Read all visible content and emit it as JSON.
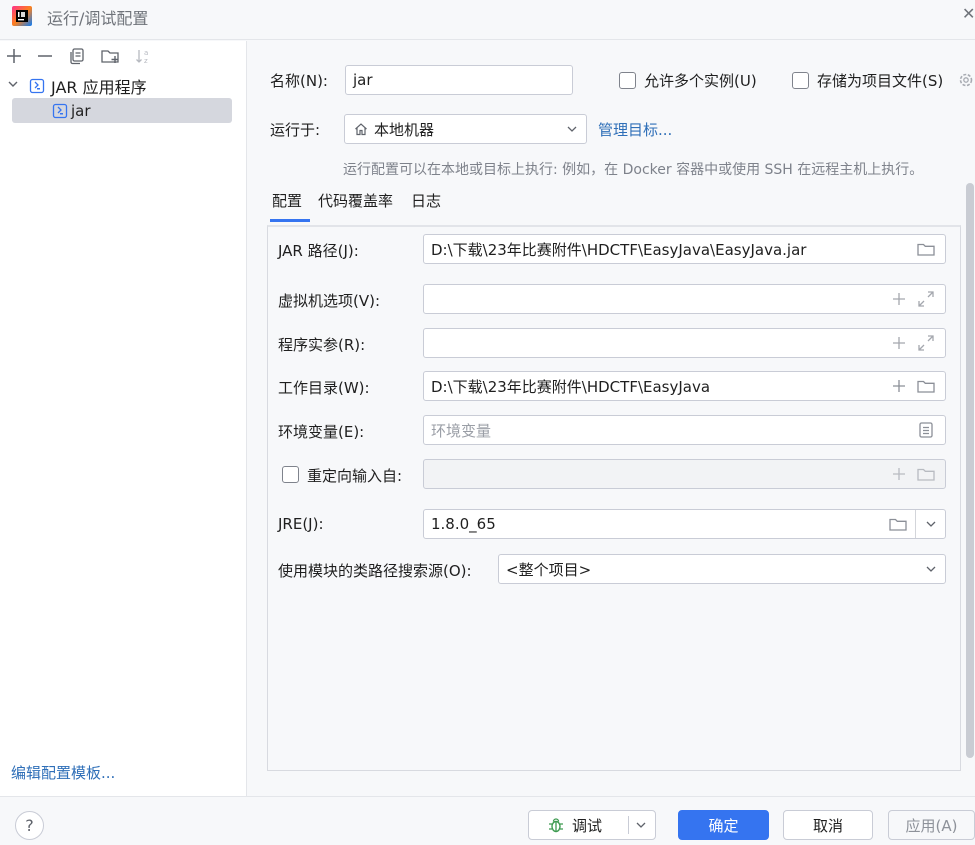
{
  "window": {
    "title": "运行/调试配置"
  },
  "left": {
    "toolbar": [
      "add-icon",
      "remove-icon",
      "copy-icon",
      "new-folder-icon",
      "sort-icon"
    ],
    "tree": [
      {
        "label": "JAR 应用程序",
        "expanded": true
      },
      {
        "label": "jar",
        "selected": true
      }
    ],
    "edit_templates_link": "编辑配置模板..."
  },
  "form": {
    "name_label": "名称(N):",
    "name_value": "jar",
    "allow_parallel": "允许多个实例(U)",
    "store_as_file": "存储为项目文件(S)",
    "run_on_label": "运行于:",
    "run_on_value": "本地机器",
    "manage_targets": "管理目标...",
    "run_on_hint": "运行配置可以在本地或目标上执行: 例如，在 Docker 容器中或使用 SSH 在远程主机上执行。",
    "tabs": [
      "配置",
      "代码覆盖率",
      "日志"
    ],
    "active_tab": "配置",
    "fields": {
      "jar_path_label": "JAR 路径(J):",
      "jar_path_value": "D:\\下载\\23年比赛附件\\HDCTF\\EasyJava\\EasyJava.jar",
      "vm_options_label": "虚拟机选项(V):",
      "vm_options_value": "",
      "program_args_label": "程序实参(R):",
      "program_args_value": "",
      "working_dir_label": "工作目录(W):",
      "working_dir_value": "D:\\下载\\23年比赛附件\\HDCTF\\EasyJava",
      "env_vars_label": "环境变量(E):",
      "env_vars_placeholder": "环境变量",
      "redirect_input_label": "重定向输入自:",
      "jre_label": "JRE(J):",
      "jre_value": "1.8.0_65",
      "module_classpath_label": "使用模块的类路径搜索源(O):",
      "module_classpath_value": "<整个项目>"
    }
  },
  "buttons": {
    "help": "?",
    "debug": "调试",
    "ok": "确定",
    "cancel": "取消",
    "apply": "应用(A)"
  },
  "colors": {
    "accent": "#3574f0",
    "link": "#2f6fb8",
    "selection": "#d5d7de"
  }
}
